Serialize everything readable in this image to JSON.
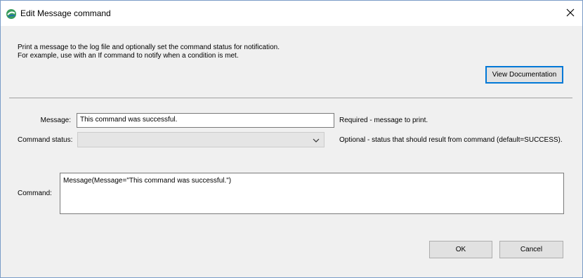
{
  "window": {
    "title": "Edit Message command",
    "icons": {
      "app": "app-logo-icon",
      "close": "close-icon"
    }
  },
  "description": {
    "line1": "Print a message to the log file and optionally set the command status for notification.",
    "line2": "For example, use with an If command to notify when a condition is met."
  },
  "buttons": {
    "view_documentation": "View Documentation",
    "ok": "OK",
    "cancel": "Cancel"
  },
  "form": {
    "message": {
      "label": "Message:",
      "value": "This command was successful.",
      "hint": "Required - message to print."
    },
    "command_status": {
      "label": "Command status:",
      "value": "",
      "hint": "Optional - status that should result from command (default=SUCCESS)."
    },
    "command": {
      "label": "Command:",
      "value": "Message(Message=\"This command was successful.\")"
    }
  },
  "colors": {
    "window_bg": "#f0f0f0",
    "accent": "#0078d7",
    "app_icon_green": "#3a9d5d"
  }
}
